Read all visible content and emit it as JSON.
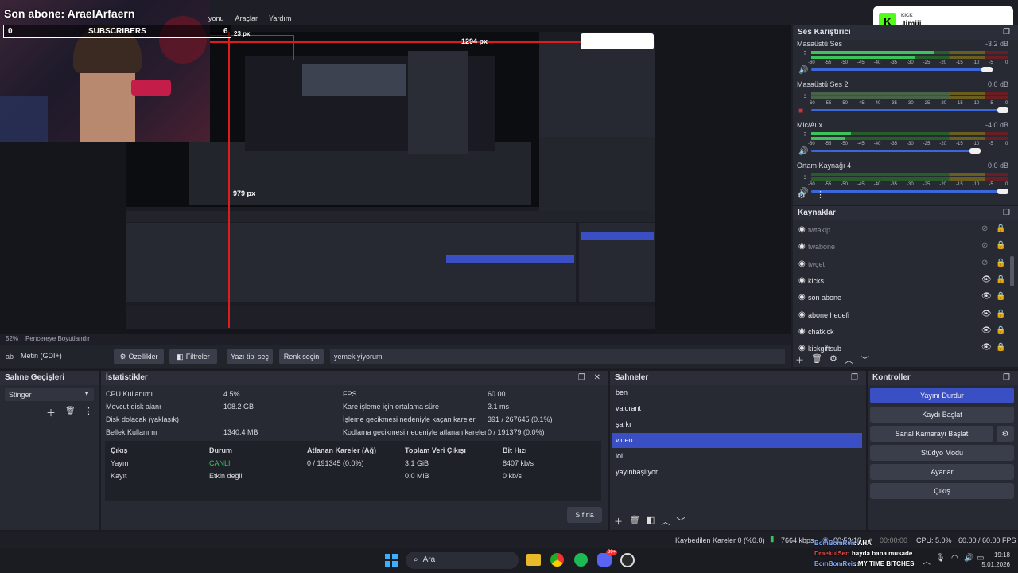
{
  "webcam_overlay": {
    "last_sub_label": "Son abone: AraelArfaern",
    "counter_left": "0",
    "counter_label": "SUBSCRIBERS",
    "counter_right": "6"
  },
  "menu": {
    "items": [
      "yonu",
      "Araçlar",
      "Yardım"
    ]
  },
  "preview": {
    "measure_1": "1294 px",
    "measure_2": "23 px",
    "measure_3": "979 px",
    "kick_brand": "KICK",
    "kick_name": "Jimjii"
  },
  "zoom": {
    "value": "52%",
    "label": "Pencereye Boyutlandır"
  },
  "source_toolbar": {
    "source_name": "Metin (GDI+)",
    "properties": "Özellikler",
    "filters": "Filtreler",
    "font_select": "Yazı tipi seç",
    "color_select": "Renk seçin",
    "text_value": "yemek yiyorum"
  },
  "mixer": {
    "title": "Ses Karıştırıcı",
    "channels": [
      {
        "name": "Masaüstü Ses",
        "db": "-3.2 dB",
        "level": 0.62,
        "volume": 0.92,
        "muted": false
      },
      {
        "name": "Masaüstü Ses 2",
        "db": "0.0 dB",
        "level": 0.0,
        "volume": 1.0,
        "muted": true
      },
      {
        "name": "Mic/Aux",
        "db": "-4.0 dB",
        "level": 0.2,
        "volume": 0.86,
        "muted": false
      },
      {
        "name": "Ortam Kaynağı 4",
        "db": "0.0 dB",
        "level": 0.0,
        "volume": 1.0,
        "muted": false
      }
    ],
    "ticks": [
      "-60",
      "-55",
      "-50",
      "-45",
      "-40",
      "-35",
      "-30",
      "-25",
      "-20",
      "-15",
      "-10",
      "-5",
      "0"
    ]
  },
  "sources": {
    "title": "Kaynaklar",
    "items": [
      {
        "name": "twtakip",
        "visible": false,
        "locked": true
      },
      {
        "name": "twabone",
        "visible": false,
        "locked": true
      },
      {
        "name": "twçet",
        "visible": false,
        "locked": true
      },
      {
        "name": "kicks",
        "visible": true,
        "locked": true
      },
      {
        "name": "son abone",
        "visible": true,
        "locked": true
      },
      {
        "name": "abone hedefi",
        "visible": true,
        "locked": true
      },
      {
        "name": "chatkick",
        "visible": true,
        "locked": true
      },
      {
        "name": "kickgiftsub",
        "visible": true,
        "locked": true
      }
    ]
  },
  "transitions": {
    "title": "Sahne Geçişleri",
    "selected": "Stinger"
  },
  "stats": {
    "title": "İstatistikler",
    "left": [
      {
        "label": "CPU Kullanımı",
        "value": "4.5%"
      },
      {
        "label": "Mevcut disk alanı",
        "value": "108.2 GB"
      },
      {
        "label": "Disk dolacak (yaklaşık)",
        "value": ""
      },
      {
        "label": "Bellek Kullanımı",
        "value": "1340.4 MB"
      }
    ],
    "right": [
      {
        "label": "FPS",
        "value": "60.00"
      },
      {
        "label": "Kare işleme için ortalama süre",
        "value": "3.1 ms"
      },
      {
        "label": "İşleme gecikmesi nedeniyle kaçan kareler",
        "value": "391 / 267645 (0.1%)"
      },
      {
        "label": "Kodlama gecikmesi nedeniyle atlanan kareler",
        "value": "0 / 191379 (0.0%)"
      }
    ],
    "table": {
      "headers": [
        "Çıkış",
        "Durum",
        "Atlanan Kareler (Ağ)",
        "Toplam Veri Çıkışı",
        "Bit Hızı"
      ],
      "rows": [
        [
          "Yayın",
          "CANLI",
          "0 / 191345 (0.0%)",
          "3.1 GiB",
          "8407 kb/s"
        ],
        [
          "Kayıt",
          "Etkin değil",
          "",
          "0.0 MiB",
          "0 kb/s"
        ]
      ]
    },
    "reset": "Sıfırla"
  },
  "scenes": {
    "title": "Sahneler",
    "items": [
      "ben",
      "valorant",
      "şarkı",
      "video",
      "lol",
      "yayınbaşlıyor"
    ],
    "selected_index": 3
  },
  "controls": {
    "title": "Kontroller",
    "buttons": [
      "Yayını Durdur",
      "Kaydı Başlat",
      "Sanal Kamerayı Başlat",
      "Stüdyo Modu",
      "Ayarlar",
      "Çıkış"
    ]
  },
  "status": {
    "dropped": "Kaybedilen Kareler 0 (%0.0)",
    "bitrate": "7664 kbps",
    "stream_time": "00:53:10",
    "rec_time": "00:00:00",
    "cpu": "CPU: 5.0%",
    "fps": "60.00 / 60.00 FPS"
  },
  "chat": [
    {
      "user": "BomBomReiss",
      "msg": ": AHA"
    },
    {
      "user": "DraekulSert",
      "msg": ": hayda bana musade"
    },
    {
      "user": "BomBomReiss",
      "msg": ": MY TIME BITCHES"
    }
  ],
  "taskbar": {
    "search": "Ara",
    "time": "19:18",
    "date": "5.01.2026",
    "discord_badge": "99+"
  },
  "colors": {
    "accent": "#3b4fc4",
    "live": "#3cc45a",
    "kick_green": "#53fc18",
    "measure_red": "#e01b1b"
  }
}
